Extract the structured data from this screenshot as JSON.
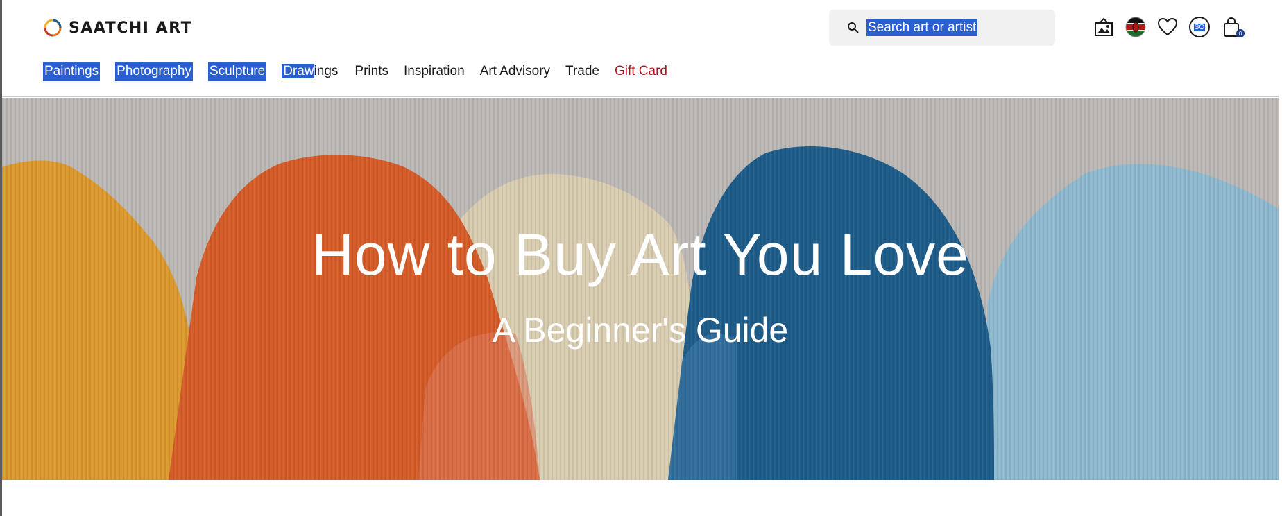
{
  "header": {
    "logo_text": "SAATCHI ART",
    "search": {
      "placeholder": "Search art or artist"
    },
    "cart_count": "0",
    "account_initials": "SO"
  },
  "nav": {
    "items": [
      {
        "label": "Paintings"
      },
      {
        "label": "Photography"
      },
      {
        "label": "Sculpture"
      },
      {
        "label_selected_part": "Draw",
        "label_rest": "ings"
      },
      {
        "label": "Prints"
      },
      {
        "label": "Inspiration"
      },
      {
        "label": "Art Advisory"
      },
      {
        "label": "Trade"
      },
      {
        "label": "Gift Card"
      }
    ]
  },
  "hero": {
    "title": "How to Buy Art You Love",
    "subtitle": "A Beginner's Guide"
  },
  "colors": {
    "selection": "#2b5fd0",
    "gift_card": "#b0121b",
    "search_bg": "#f1f1f1",
    "hero_orange": "#d65d2a",
    "hero_yellow": "#dd9a2e",
    "hero_blue": "#1f5d8a",
    "hero_light_blue": "#8fbbd1"
  },
  "icons": [
    "saatchi-logo-icon",
    "search-icon",
    "gallery-icon",
    "kenya-flag-icon",
    "heart-icon",
    "account-icon",
    "cart-icon"
  ]
}
